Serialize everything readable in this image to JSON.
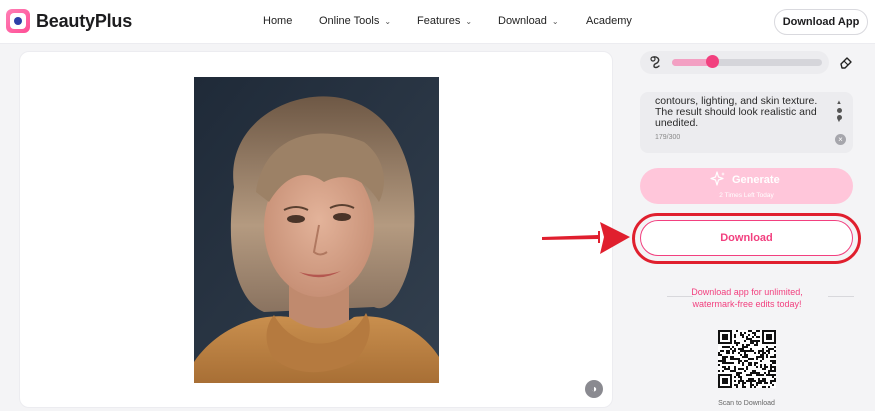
{
  "header": {
    "brand": "BeautyPlus",
    "nav": {
      "home": "Home",
      "online_tools": "Online Tools",
      "features": "Features",
      "download": "Download",
      "academy": "Academy"
    },
    "download_app": "Download App"
  },
  "editor": {
    "brush_level": 0.27,
    "prompt_text": "contours, lighting, and skin texture. The result should look realistic and unedited.",
    "char_count": "179/300",
    "generate_label": "Generate",
    "generate_sub": "2 Times Left Today",
    "download_label": "Download",
    "promo_line1": "Download app for unlimited,",
    "promo_line2": "watermark-free edits today!",
    "scan_label": "Scan to Download"
  },
  "colors": {
    "accent": "#f2407f",
    "generate_bg": "#ffc6da",
    "highlight": "#e01f2e"
  }
}
